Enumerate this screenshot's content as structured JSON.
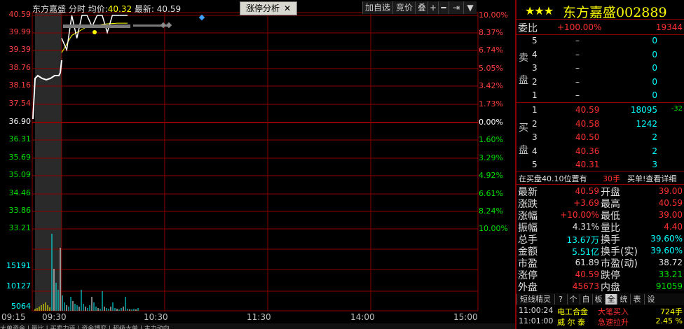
{
  "header": {
    "stock_name": "东方嘉盛",
    "mode": "分时",
    "avg_label": "均价:",
    "avg_value": "40.32",
    "latest_label": "最新:",
    "latest_value": "40.59",
    "tab_label": "涨停分析",
    "tab_close": "✕",
    "buttons": [
      "加自选",
      "竞价",
      "叠",
      "+",
      "━",
      "⇥",
      "▼"
    ]
  },
  "chart": {
    "left_axis": [
      "40.59",
      "39.99",
      "39.39",
      "38.76",
      "38.16",
      "37.54",
      "36.90",
      "36.31",
      "35.69",
      "35.09",
      "34.46",
      "33.86",
      "33.21"
    ],
    "right_axis": [
      "10.00%",
      "8.37%",
      "6.74%",
      "5.05%",
      "3.42%",
      "1.73%",
      "0.00%",
      "1.60%",
      "3.29%",
      "4.92%",
      "6.61%",
      "8.24%",
      "10.00%"
    ],
    "volume_axis": [
      "15191",
      "10127",
      "5064"
    ],
    "time_axis": [
      "09:15",
      "09:30",
      "10:30",
      "11:30",
      "14:00",
      "15:00"
    ],
    "bottom_text": "大单资金 | 量比 | 买卖力道 | 资金博弈 | 超级大单 | 主力动向"
  },
  "chart_data": {
    "type": "line",
    "title": "",
    "xlabel": "",
    "ylabel": "",
    "x": [
      "09:30",
      "09:32",
      "09:34",
      "09:36",
      "09:38",
      "09:40",
      "09:42",
      "09:45",
      "09:50",
      "09:55",
      "10:00",
      "10:05",
      "10:10",
      "10:15"
    ],
    "series": [
      {
        "name": "最新",
        "values": [
          39.8,
          39.4,
          40.59,
          39.8,
          40.59,
          40.59,
          40.2,
          40.59,
          40.59,
          40.0,
          40.59,
          40.59,
          40.59,
          40.59
        ]
      },
      {
        "name": "均价",
        "values": [
          39.3,
          39.6,
          39.9,
          40.0,
          40.1,
          40.2,
          40.2,
          40.25,
          40.28,
          40.3,
          40.31,
          40.32,
          40.32,
          40.32
        ]
      }
    ],
    "ylim": [
      33.21,
      40.59
    ]
  },
  "panel": {
    "stars": "★★★",
    "name": "东方嘉盛",
    "code": "002889",
    "weibi_label": "委比",
    "weibi_value": "+100.00%",
    "weicha_value": "19344",
    "sell_label": [
      "卖",
      "盘"
    ],
    "sell": [
      {
        "lvl": "5",
        "price": "–",
        "vol": "0"
      },
      {
        "lvl": "4",
        "price": "–",
        "vol": "0"
      },
      {
        "lvl": "3",
        "price": "–",
        "vol": "0"
      },
      {
        "lvl": "2",
        "price": "–",
        "vol": "0"
      },
      {
        "lvl": "1",
        "price": "–",
        "vol": "0"
      }
    ],
    "buy_label": [
      "买",
      "盘"
    ],
    "buy": [
      {
        "lvl": "1",
        "price": "40.59",
        "vol": "18095",
        "chg": "-32"
      },
      {
        "lvl": "2",
        "price": "40.58",
        "vol": "1242",
        "chg": ""
      },
      {
        "lvl": "3",
        "price": "40.50",
        "vol": "2",
        "chg": ""
      },
      {
        "lvl": "4",
        "price": "40.36",
        "vol": "2",
        "chg": ""
      },
      {
        "lvl": "5",
        "price": "40.31",
        "vol": "3",
        "chg": ""
      }
    ],
    "notice_text": "在买盘40.10位置有",
    "notice_qty": "30手",
    "notice_link": "买单!查看详细",
    "stats": [
      {
        "l1": "最新",
        "v1": "40.59",
        "c1": "red",
        "l2": "开盘",
        "v2": "39.00",
        "c2": "red"
      },
      {
        "l1": "涨跌",
        "v1": "+3.69",
        "c1": "red",
        "l2": "最高",
        "v2": "40.59",
        "c2": "red"
      },
      {
        "l1": "涨幅",
        "v1": "+10.00%",
        "c1": "red",
        "l2": "最低",
        "v2": "39.00",
        "c2": "red"
      },
      {
        "l1": "振幅",
        "v1": "4.31%",
        "c1": "wht",
        "l2": "量比",
        "v2": "4.40",
        "c2": "red"
      },
      {
        "l1": "总手",
        "v1": "13.67万",
        "c1": "cyn",
        "l2": "换手",
        "v2": "39.60%",
        "c2": "cyn"
      },
      {
        "l1": "金额",
        "v1": "5.51亿",
        "c1": "cyn",
        "l2": "换手(实)",
        "v2": "39.60%",
        "c2": "cyn"
      },
      {
        "l1": "市盈",
        "v1": "61.89",
        "c1": "wht",
        "l2": "市盈(动)",
        "v2": "38.72",
        "c2": "wht"
      },
      {
        "l1": "涨停",
        "v1": "40.59",
        "c1": "red",
        "l2": "跌停",
        "v2": "33.21",
        "c2": "grn"
      },
      {
        "l1": "外盘",
        "v1": "45673",
        "c1": "red",
        "l2": "内盘",
        "v2": "91059",
        "c2": "grn"
      }
    ],
    "quick_tabs": [
      "短线精灵",
      "?",
      "个",
      "自",
      "板",
      "全",
      "统",
      "表",
      "设"
    ],
    "alerts": [
      {
        "time": "11:00:24",
        "name": "电工合金",
        "type": "大笔买入",
        "val": "724手"
      },
      {
        "time": "11:01:00",
        "name": "威 尔 泰",
        "type": "急速拉升",
        "val": "2.45 %"
      }
    ]
  }
}
